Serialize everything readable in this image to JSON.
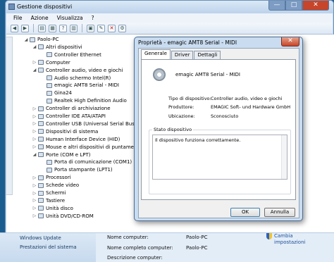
{
  "main_window": {
    "title": "Gestione dispositivi",
    "menu": [
      "File",
      "Azione",
      "Visualizza",
      "?"
    ],
    "controls": [
      "—",
      "□",
      "✕"
    ]
  },
  "tree": {
    "root": "Paolo-PC",
    "items": [
      {
        "label": "Altri dispositivi",
        "level": 1,
        "expanded": true
      },
      {
        "label": "Controller Ethernet",
        "level": 2
      },
      {
        "label": "Computer",
        "level": 1
      },
      {
        "label": "Controller audio, video e giochi",
        "level": 1,
        "expanded": true
      },
      {
        "label": "Audio schermo Intel(R)",
        "level": 2
      },
      {
        "label": "emagic AMT8 Serial - MIDI",
        "level": 2
      },
      {
        "label": "Gina24",
        "level": 2
      },
      {
        "label": "Realtek High Definition Audio",
        "level": 2
      },
      {
        "label": "Controller di archiviazione",
        "level": 1
      },
      {
        "label": "Controller IDE ATA/ATAPI",
        "level": 1
      },
      {
        "label": "Controller USB (Universal Serial Bus)",
        "level": 1
      },
      {
        "label": "Dispositivi di sistema",
        "level": 1
      },
      {
        "label": "Human Interface Device (HID)",
        "level": 1
      },
      {
        "label": "Mouse e altri dispositivi di puntamento",
        "level": 1
      },
      {
        "label": "Porte (COM e LPT)",
        "level": 1,
        "expanded": true
      },
      {
        "label": "Porta di comunicazione (COM1)",
        "level": 2
      },
      {
        "label": "Porta stampante (LPT1)",
        "level": 2
      },
      {
        "label": "Processori",
        "level": 1
      },
      {
        "label": "Schede video",
        "level": 1
      },
      {
        "label": "Schermi",
        "level": 1
      },
      {
        "label": "Tastiere",
        "level": 1
      },
      {
        "label": "Unità disco",
        "level": 1
      },
      {
        "label": "Unità DVD/CD-ROM",
        "level": 1
      }
    ]
  },
  "dialog": {
    "title": "Proprietà - emagic AMT8 Serial - MIDI",
    "tabs": [
      "Generale",
      "Driver",
      "Dettagli"
    ],
    "active_tab": "Generale",
    "device_name": "emagic AMT8 Serial - MIDI",
    "properties": [
      {
        "label": "Tipo di dispositivo:",
        "value": "Controller audio, video e giochi"
      },
      {
        "label": "Produttore:",
        "value": "EMAGIC Soft- und Hardware GmbH"
      },
      {
        "label": "Ubicazione:",
        "value": "Sconosciuto"
      }
    ],
    "status_label": "Stato dispositivo",
    "status_text": "Il dispositivo funziona correttamente.",
    "ok_label": "OK",
    "cancel_label": "Annulla"
  },
  "background_panel": {
    "left_links": [
      "Windows Update",
      "Prestazioni del sistema"
    ],
    "info": [
      {
        "label": "Nome computer:",
        "value": "Paolo-PC"
      },
      {
        "label": "Nome completo computer:",
        "value": "Paolo-PC"
      },
      {
        "label": "Descrizione computer:",
        "value": ""
      }
    ],
    "change_link": "Cambia impostazioni"
  }
}
